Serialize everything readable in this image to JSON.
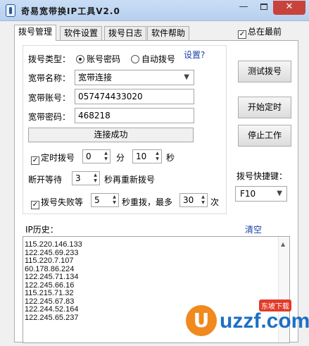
{
  "window": {
    "title": "奇易宽带换IP工具V2.0"
  },
  "tabs": [
    "拨号管理",
    "软件设置",
    "拨号日志",
    "软件帮助"
  ],
  "always_on_top": {
    "label": "总在最前",
    "checked": true
  },
  "dial": {
    "type_label": "拨号类型：",
    "radio_password": "账号密码",
    "radio_auto": "自动拨号",
    "settings_link": "设置?",
    "name_label": "宽带名称：",
    "name_value": "宽带连接",
    "account_label": "宽带账号：",
    "account_value": "057474433020",
    "password_label": "宽带密码：",
    "password_value": "468218",
    "status": "连接成功",
    "timer_label": "定时拨号",
    "timer_min": "0",
    "min_unit": "分",
    "timer_sec": "10",
    "sec_unit": "秒",
    "disconnect_label": "断开等待",
    "disconnect_value": "3",
    "redial_text": "秒再重新拨号",
    "fail_label": "拨号失败等",
    "fail_wait": "5",
    "fail_text": "秒重拨，最多",
    "fail_max": "30",
    "times_unit": "次"
  },
  "buttons": {
    "test": "测试拨号",
    "start_timer": "开始定时",
    "stop": "停止工作"
  },
  "hotkey": {
    "label": "拨号快捷键：",
    "value": "F10"
  },
  "history": {
    "label": "IP历史：",
    "clear": "清空",
    "ips": [
      "115.220.146.133",
      "122.245.69.233",
      "115.220.7.107",
      "60.178.86.224",
      "122.245.71.134",
      "122.245.66.16",
      "115.215.71.32",
      "122.245.67.83",
      "122.244.52.164",
      "122.245.65.237"
    ]
  },
  "watermark": {
    "text": "uzzf.com",
    "badge": "东坡下载"
  }
}
